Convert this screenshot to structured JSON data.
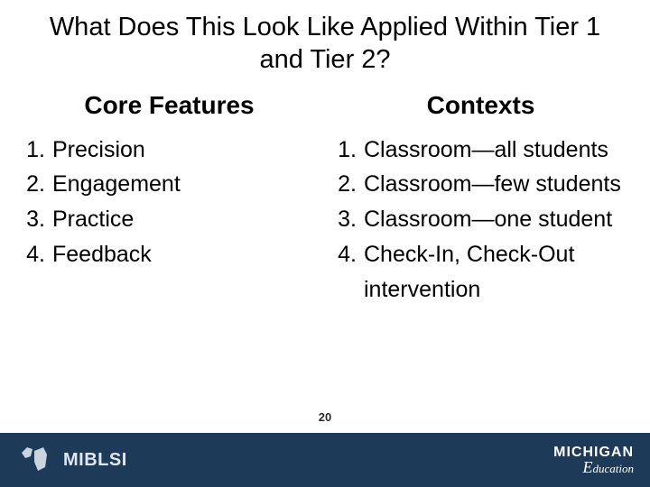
{
  "title": "What Does This Look Like Applied Within Tier 1 and Tier 2?",
  "columns": {
    "left": {
      "heading": "Core Features",
      "items": [
        "Precision",
        "Engagement",
        "Practice",
        "Feedback"
      ]
    },
    "right": {
      "heading": "Contexts",
      "items": [
        "Classroom—all students",
        "Classroom—few students",
        "Classroom—one student",
        "Check-In, Check-Out intervention"
      ]
    }
  },
  "page_number": "20",
  "footer": {
    "left_brand": "MIBLSI",
    "right_brand_top": "MICHIGAN",
    "right_brand_bottom_prefix": "E",
    "right_brand_bottom_rest": "ducation"
  }
}
